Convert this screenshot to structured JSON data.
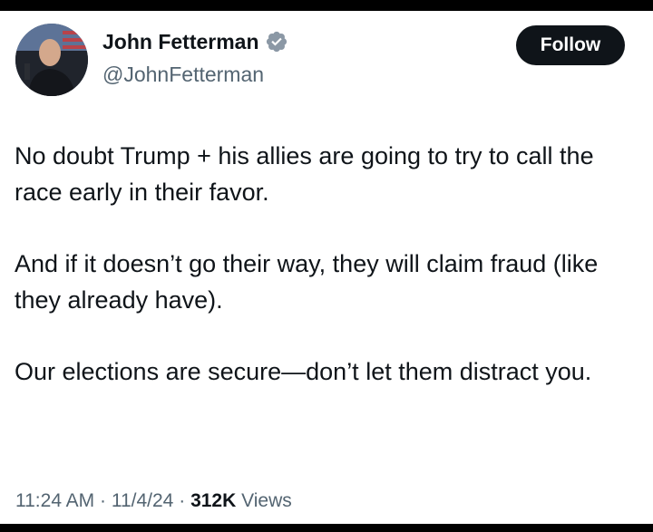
{
  "author": {
    "name": "John Fetterman",
    "handle": "@JohnFetterman",
    "verified": true,
    "verified_icon": "verified-badge-icon",
    "verified_color": "#8b98a5"
  },
  "actions": {
    "follow_label": "Follow"
  },
  "tweet": {
    "paragraphs": [
      "No doubt Trump + his allies are going to try to call the race early in their favor.",
      "And if it doesn’t go their way, they will claim fraud (like they already have).",
      "Our elections are secure—don’t let them distract you."
    ]
  },
  "meta": {
    "time": "11:24 AM",
    "separator": "·",
    "date": "11/4/24",
    "views_count": "312K",
    "views_label": "Views"
  },
  "colors": {
    "text_primary": "#0f1419",
    "text_secondary": "#536471",
    "button_bg": "#0f1419",
    "button_text": "#ffffff",
    "background": "#ffffff"
  }
}
